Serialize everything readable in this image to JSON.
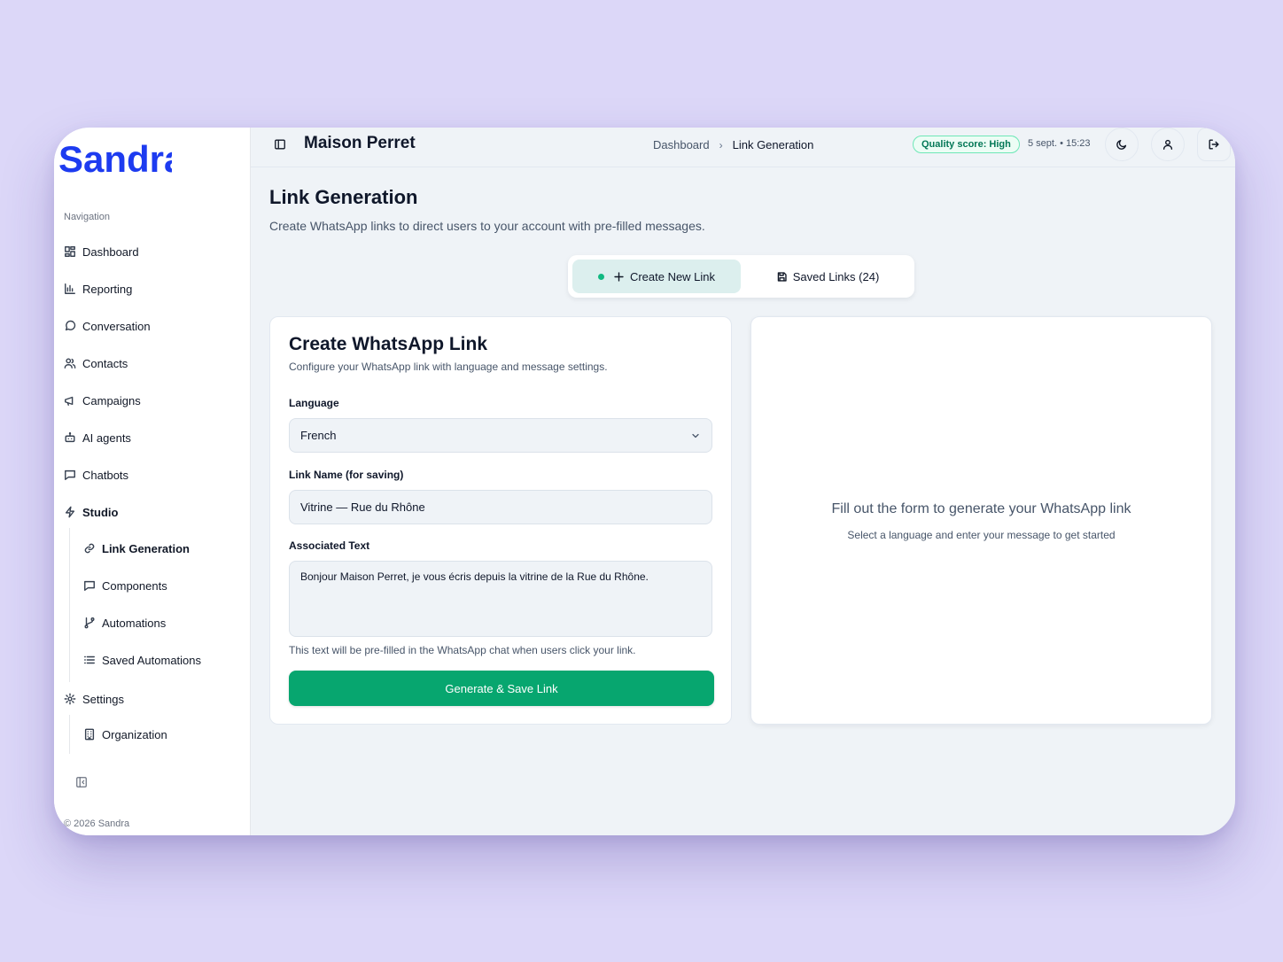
{
  "app": {
    "logo_text": "Sandra",
    "copyright": "© 2026 Sandra"
  },
  "colors": {
    "brand": "#1d3bf0",
    "accent": "#07a66f",
    "background": "#dcd7f8"
  },
  "sidebar": {
    "heading": "Navigation",
    "items": [
      {
        "label": "Dashboard",
        "icon": "grid-icon"
      },
      {
        "label": "Reporting",
        "icon": "bar-chart-icon"
      },
      {
        "label": "Conversation",
        "icon": "chat-bubble-icon"
      },
      {
        "label": "Contacts",
        "icon": "users-icon"
      },
      {
        "label": "Campaigns",
        "icon": "megaphone-icon"
      },
      {
        "label": "AI agents",
        "icon": "robot-icon"
      },
      {
        "label": "Chatbots",
        "icon": "message-square-icon"
      },
      {
        "label": "Studio",
        "icon": "zap-icon"
      }
    ],
    "studio_items": [
      {
        "label": "Link Generation",
        "icon": "link-icon"
      },
      {
        "label": "Components",
        "icon": "message-square-icon"
      },
      {
        "label": "Automations",
        "icon": "git-branch-icon"
      },
      {
        "label": "Saved Automations",
        "icon": "list-icon"
      }
    ],
    "settings": {
      "label": "Settings",
      "icon": "gear-icon"
    },
    "settings_items": [
      {
        "label": "Organization",
        "icon": "building-icon"
      }
    ]
  },
  "header": {
    "org_name": "Maison Perret",
    "breadcrumb": [
      "Dashboard",
      "Link Generation"
    ],
    "quality_badge": "Quality score: High",
    "datetime": "5 sept. • 15:23"
  },
  "main": {
    "title": "Link Generation",
    "subtitle": "Create WhatsApp links to direct users to your account with pre-filled messages.",
    "tabs": [
      {
        "label": "Create New Link",
        "active": true
      },
      {
        "label": "Saved Links (24)",
        "active": false
      }
    ],
    "form": {
      "title": "Create WhatsApp Link",
      "subtitle": "Configure your WhatsApp link with language and message settings.",
      "language_label": "Language",
      "language_value": "French",
      "link_name_label": "Link Name (for saving)",
      "link_name_value": "Vitrine — Rue du Rhône",
      "text_label": "Associated Text",
      "text_value": "Bonjour Maison Perret, je vous écris depuis la vitrine de la Rue du Rhône.",
      "hint": "This text will be pre-filled in the WhatsApp chat when users click your link.",
      "submit_label": "Generate & Save Link"
    },
    "preview": {
      "title": "Fill out the form to generate your WhatsApp link",
      "subtitle": "Select a language and enter your message to get started"
    }
  }
}
